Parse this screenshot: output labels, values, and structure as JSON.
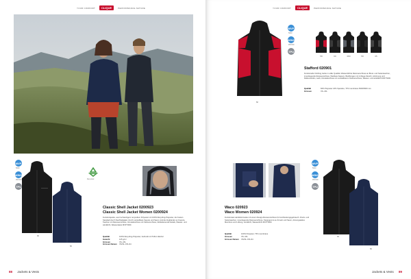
{
  "header": {
    "left_label": "YOUR COMFORT",
    "logo": "CLIQUE",
    "right_label": "PERFORMANCE NATURE"
  },
  "footer": {
    "left_page_number": "88",
    "left_section": "Jackets & Vests",
    "right_section": "Jackets & Vests",
    "right_page_number": "89"
  },
  "stafford": {
    "title": "Stafford 020901",
    "description": "Funktionelle Clothing Jacke in edler Qualität. Wasserdichte Reissverschluss an Brust- und Seitentaschen, innenliegende Reissverschluss, Weitbare Kapuze, Belüftungen mit 4-Wege-Stretch, Anbrinung und Reflexstreifen, weiß, Ärmelabschluss mit verstellbarem Klettverschluss, Wasser- und winddicht MVP 5000.",
    "specs": [
      {
        "key": "Qualität",
        "value": "84% Polyester 16% Spandex, TPU membrane 5000/5000 mm"
      },
      {
        "key": "Grössen",
        "value": "XS–4XL"
      }
    ],
    "main_code": "58",
    "color_codes": [
      "58",
      "99",
      "380",
      "58",
      "35"
    ]
  },
  "classic_shell": {
    "title_line1": "Classic Shell Jacket 0200923",
    "title_line2": "Classic Shell Jacket Women 0200924",
    "description": "Funktionsjacke, aus hochwertigem recyceltem Polyester mit 100% Recycling-Polyester, der besten Standard durch Nachhaltigkeit. Durch verstellbare Kapuze und Saum sind die Zugbänder an Kapuze, Taschen mit Reissverschluss, Ärmelabschluss mit Klettverschluss, Reflektierende Details, Wasser- und winddicht, Wassersäule MVP 5000.",
    "specs": [
      {
        "key": "Qualität",
        "value": "100% Recycling-Polyester, bedruckt mit Teflon Alkohol"
      },
      {
        "key": "Gewicht",
        "value": "125 g/m²"
      },
      {
        "key": "Grössen",
        "value": "XS–4XL"
      },
      {
        "key": "Grössen Damen",
        "value": "XS/34–XXL/44"
      }
    ],
    "code_mens": "99",
    "code_womens": "58",
    "recycled_label": "Recycled"
  },
  "waco": {
    "title_line1": "Waco 020923",
    "title_line2": "Waco Women 020924",
    "description": "Funktionale Hardshell-Jacke mit einem Design-Reissverschluss für Hochleistungsgebrauch. Druck- und Seitentaschen, innenliegende Reissverschluss, Steppgummi an Ärmeln und Saum, Atmungsaktive Membran und Lüftung, winddicht, Wasserdicht MVP 5000.",
    "specs": [
      {
        "key": "Qualität",
        "value": "100% Polyester, TPU-membrane"
      },
      {
        "key": "Grössen",
        "value": "XS–4XL"
      },
      {
        "key": "Grössen Damen",
        "value": "XS/34–XXL/44"
      }
    ],
    "code_mens": "99",
    "code_womens": "58"
  },
  "feature_icons": [
    {
      "text": "MVP",
      "label": "5000"
    },
    {
      "text": "WIND",
      "label": "PROOF"
    },
    {
      "text": "TPU",
      "label": "TEFLON"
    }
  ],
  "colors": {
    "brand_red": "#c8102e",
    "badge_blue": "#3a8fd6",
    "badge_grey": "#8a8f96",
    "navy": "#1e2a4a",
    "black": "#1a1a1a"
  }
}
